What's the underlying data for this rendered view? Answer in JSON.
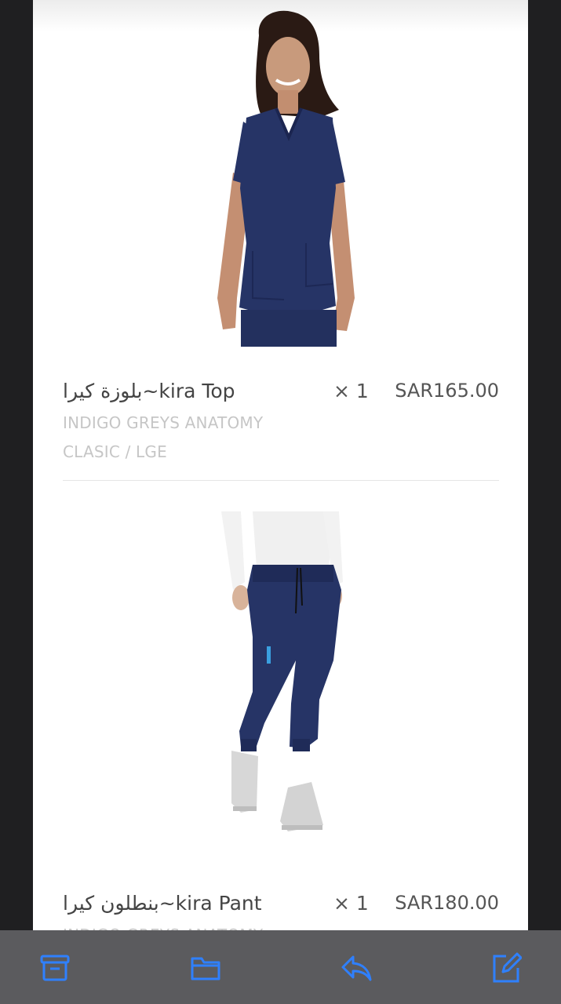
{
  "order_items": [
    {
      "name": "بلوزة كيرا~kira Top",
      "quantity": "× 1",
      "price": "SAR165.00",
      "variant": "INDIGO GREYS ANATOMY",
      "size": "CLASIC / LGE"
    },
    {
      "name": "بنطلون كيرا~kira Pant",
      "quantity": "× 1",
      "price": "SAR180.00",
      "variant": "INDIGO GREYS ANATOMY"
    }
  ],
  "toolbar": {
    "icons": [
      "archive-icon",
      "folder-icon",
      "reply-icon",
      "compose-icon"
    ],
    "icon_color": "#2f80ff"
  },
  "colors": {
    "scrub_navy": "#263466",
    "background_dark": "#1f1f21",
    "toolbar_bg": "#5b5b5e"
  }
}
